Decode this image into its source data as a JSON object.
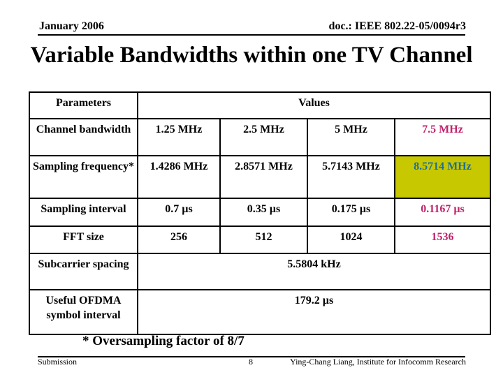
{
  "header": {
    "date": "January 2006",
    "doc_id": "doc.: IEEE 802.22-05/0094r3"
  },
  "title": "Variable Bandwidths within one TV Channel",
  "table": {
    "header": {
      "parameters": "Parameters",
      "values": "Values"
    },
    "rows": [
      {
        "param": "Channel bandwidth",
        "values": [
          "1.25 MHz",
          "2.5 MHz",
          "5 MHz",
          "7.5 MHz"
        ]
      },
      {
        "param": "Sampling frequency*",
        "values": [
          "1.4286 MHz",
          "2.8571 MHz",
          "5.7143 MHz",
          "8.5714 MHz"
        ]
      },
      {
        "param": "Sampling interval",
        "values": [
          "0.7 µs",
          "0.35 µs",
          "0.175 µs",
          "0.1167 µs"
        ]
      },
      {
        "param": "FFT size",
        "values": [
          "256",
          "512",
          "1024",
          "1536"
        ]
      },
      {
        "param": "Subcarrier spacing",
        "value": "5.5804 kHz"
      },
      {
        "param": "Useful OFDMA symbol interval",
        "value": "179.2 µs"
      }
    ],
    "colors": {
      "highlight_text": "#c0226b",
      "highlight_cell_bg": "#c8c800",
      "highlight_cell_text": "#1f6f8f"
    }
  },
  "footnote": "* Oversampling factor of 8/7",
  "footer": {
    "left": "Submission",
    "page": "8",
    "right": "Ying-Chang Liang, Institute for Infocomm Research"
  }
}
